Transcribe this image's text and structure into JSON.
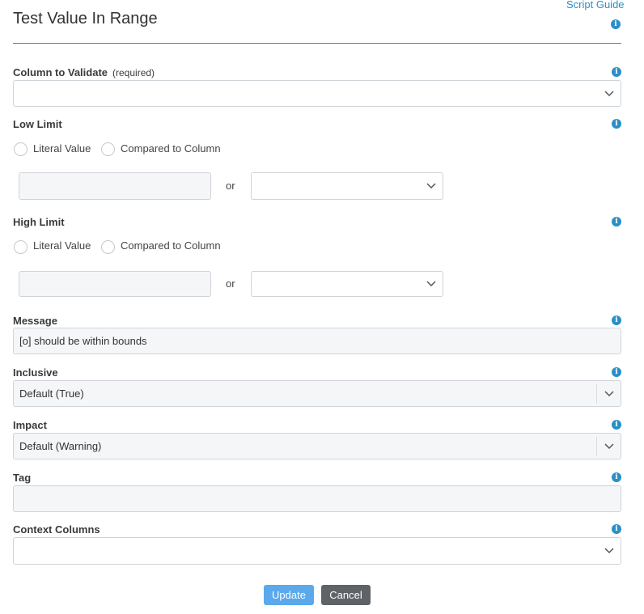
{
  "header": {
    "title": "Test Value In Range",
    "script_guide": "Script Guide"
  },
  "column_to_validate": {
    "label": "Column to Validate",
    "required": "(required)",
    "value": ""
  },
  "low_limit": {
    "label": "Low Limit",
    "option_literal": "Literal Value",
    "option_compared": "Compared to Column",
    "literal_value": "",
    "or": "or",
    "column_value": ""
  },
  "high_limit": {
    "label": "High Limit",
    "option_literal": "Literal Value",
    "option_compared": "Compared to Column",
    "literal_value": "",
    "or": "or",
    "column_value": ""
  },
  "message": {
    "label": "Message",
    "value": "[o] should be within bounds"
  },
  "inclusive": {
    "label": "Inclusive",
    "value": "Default (True)"
  },
  "impact": {
    "label": "Impact",
    "value": "Default (Warning)"
  },
  "tag": {
    "label": "Tag",
    "value": ""
  },
  "context_columns": {
    "label": "Context Columns",
    "value": ""
  },
  "buttons": {
    "update": "Update",
    "cancel": "Cancel"
  },
  "icons": {
    "info": "info-icon",
    "dropdown": "chevron-down-icon"
  },
  "colors": {
    "accent": "#2a8fc7",
    "update_button": "#5aa9ec",
    "cancel_button": "#5f6368"
  }
}
